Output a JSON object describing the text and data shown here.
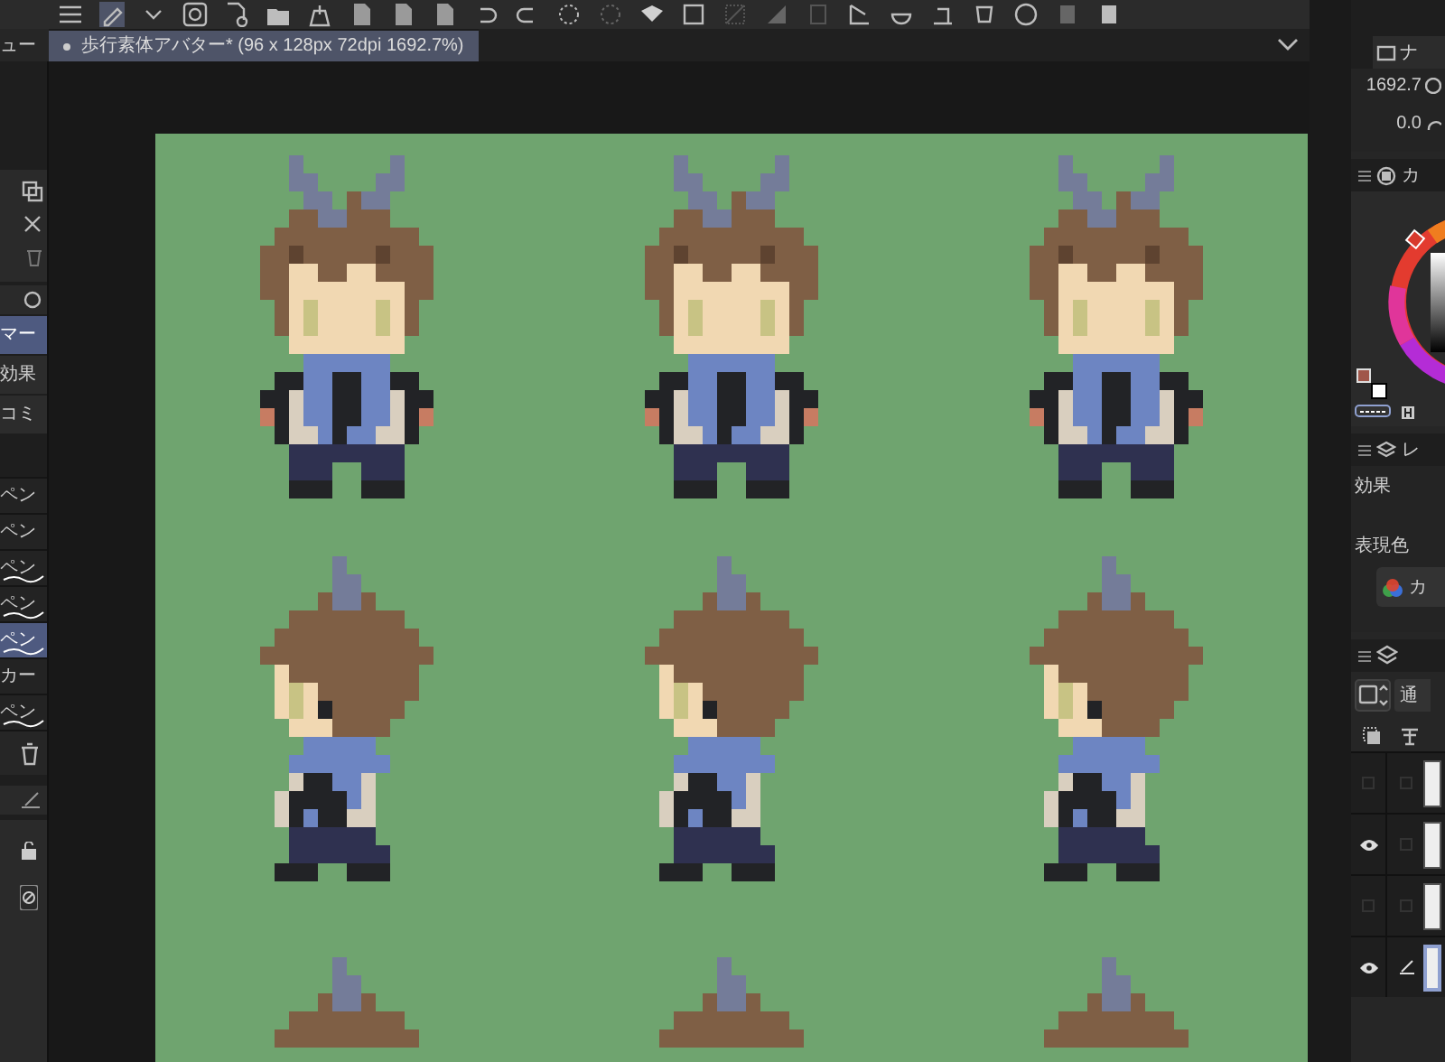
{
  "left_panel": {
    "tab_label": "ュー",
    "categories": [
      {
        "label": "マー",
        "selected": true
      },
      {
        "label": "効果",
        "selected": false
      },
      {
        "label": "コミ",
        "selected": false
      }
    ],
    "subtools": [
      {
        "label": "ペン",
        "preview": false,
        "selected": false
      },
      {
        "label": "ペン",
        "preview": false,
        "selected": false
      },
      {
        "label": "ペン",
        "preview": true,
        "selected": false
      },
      {
        "label": "ペン",
        "preview": true,
        "selected": false
      },
      {
        "label": "ペン",
        "preview": true,
        "selected": true
      },
      {
        "label": "カー",
        "preview": false,
        "selected": false
      },
      {
        "label": "ペン",
        "preview": true,
        "selected": false
      }
    ]
  },
  "document_tab": {
    "title": "歩行素体アバター* (96 x 128px 72dpi 1692.7%)"
  },
  "canvas": {
    "sprites": [
      {
        "kind": "front"
      },
      {
        "kind": "front"
      },
      {
        "kind": "front"
      },
      {
        "kind": "side"
      },
      {
        "kind": "side"
      },
      {
        "kind": "side"
      },
      {
        "kind": "side_top"
      },
      {
        "kind": "side_top"
      },
      {
        "kind": "side_top"
      }
    ]
  },
  "right_panel": {
    "top_tab": "ナ",
    "zoom": "1692.7",
    "angle": "0.0",
    "color_tab": "カ",
    "layer_property_tab": "レ",
    "effect_label": "効果",
    "expression_label": "表現色",
    "expression_button": "カ",
    "layers": {
      "blend_mode": "通",
      "rows": [
        {
          "visible": false,
          "editing": false,
          "selected": false
        },
        {
          "visible": true,
          "editing": false,
          "selected": false
        },
        {
          "visible": false,
          "editing": false,
          "selected": false
        },
        {
          "visible": true,
          "editing": true,
          "selected": true
        }
      ]
    }
  }
}
